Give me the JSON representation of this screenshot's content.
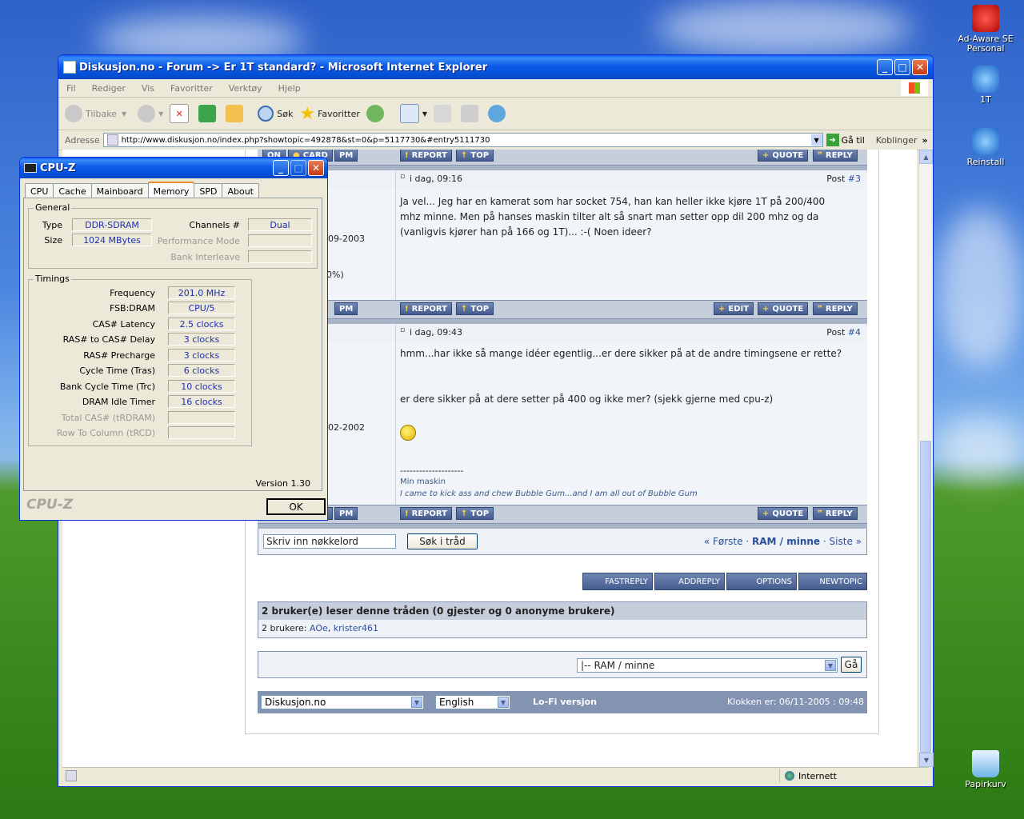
{
  "desktop": {
    "icons": [
      {
        "label": "Ad-Aware SE Personal"
      },
      {
        "label": "1T"
      },
      {
        "label": "Reinstall"
      },
      {
        "label": "Papirkurv"
      }
    ]
  },
  "ie": {
    "title": "Diskusjon.no - Forum -> Er 1T standard? - Microsoft Internet Explorer",
    "menu": [
      "Fil",
      "Rediger",
      "Vis",
      "Favoritter",
      "Verktøy",
      "Hjelp"
    ],
    "toolbar": {
      "back": "Tilbake",
      "search": "Søk",
      "favorites": "Favoritter"
    },
    "address": {
      "label": "Adresse",
      "url": "http://www.diskusjon.no/index.php?showtopic=492878&st=0&p=5117730&#entry5111730",
      "go": "Gå til",
      "links": "Koblinger"
    },
    "status": {
      "zone": "Internett"
    }
  },
  "forum": {
    "buttons": {
      "on": "ON",
      "card": "CARD",
      "pm": "PM",
      "report": "REPORT",
      "top": "TOP",
      "edit": "EDIT",
      "quote": "QUOTE",
      "reply": "REPLY"
    },
    "partial_left": {
      "date3": "09-2003",
      "percent3": "0%)",
      "date4": "02-2002"
    },
    "posts": [
      {
        "time": "i dag, 09:16",
        "post_label": "Post",
        "post_num": "#3",
        "text": "Ja vel... Jeg har en kamerat som har socket 754, han kan heller ikke kjøre 1T på 200/400 mhz minne. Men på hanses maskin tilter alt så snart man setter opp dil 200 mhz og da (vanligvis kjører han på 166 og 1T)... :-( Noen ideer?"
      },
      {
        "time": "i dag, 09:43",
        "post_label": "Post",
        "post_num": "#4",
        "text1": "hmm...har ikke så mange idéer egentlig...er dere sikker på at de andre timingsene er rette?",
        "text2": "er dere sikker på at dere setter på 400 og ikke mer? (sjekk gjerne med cpu-z)",
        "sig_line": "--------------------",
        "sig_link": "Min maskin",
        "sig_quote": "I came to kick ass and chew Bubble Gum...and I am all out of Bubble Gum"
      }
    ],
    "search": {
      "placeholder": "Skriv inn nøkkelord",
      "button": "Søk i tråd"
    },
    "pagination": {
      "first": "« Første",
      "sep1": "·",
      "current": "RAM / minne",
      "sep2": "·",
      "last": "Siste »"
    },
    "actions": {
      "fastreply": "FASTREPLY",
      "addreply": "ADDREPLY",
      "options": "OPTIONS",
      "newtopic": "NEWTOPIC"
    },
    "readers": {
      "header": "2 bruker(e) leser denne tråden (0 gjester og 0 anonyme brukere)",
      "prefix": "2 brukere:",
      "user1": "AOe",
      "comma": ",",
      "user2": "krister461"
    },
    "jump": {
      "selected": "|-- RAM / minne",
      "go": "Gå"
    },
    "footer": {
      "site": "Diskusjon.no",
      "lang": "English",
      "lofi": "Lo-Fi versjon",
      "clock": "Klokken er: 06/11-2005 : 09:48"
    }
  },
  "cpuz": {
    "title": "CPU-Z",
    "tabs": [
      "CPU",
      "Cache",
      "Mainboard",
      "Memory",
      "SPD",
      "About"
    ],
    "active_tab": "Memory",
    "general": {
      "legend": "General",
      "type_label": "Type",
      "type_value": "DDR-SDRAM",
      "size_label": "Size",
      "size_value": "1024 MBytes",
      "channels_label": "Channels #",
      "channels_value": "Dual",
      "perf_label": "Performance Mode",
      "bank_label": "Bank Interleave"
    },
    "timings": {
      "legend": "Timings",
      "rows": [
        {
          "label": "Frequency",
          "value": "201.0 MHz"
        },
        {
          "label": "FSB:DRAM",
          "value": "CPU/5"
        },
        {
          "label": "CAS# Latency",
          "value": "2.5 clocks"
        },
        {
          "label": "RAS# to CAS# Delay",
          "value": "3 clocks"
        },
        {
          "label": "RAS# Precharge",
          "value": "3 clocks"
        },
        {
          "label": "Cycle Time (Tras)",
          "value": "6 clocks"
        },
        {
          "label": "Bank Cycle Time (Trc)",
          "value": "10 clocks"
        },
        {
          "label": "DRAM Idle Timer",
          "value": "16 clocks"
        }
      ],
      "disabled": [
        {
          "label": "Total CAS# (tRDRAM)"
        },
        {
          "label": "Row To Column (tRCD)"
        }
      ]
    },
    "version": "Version 1.30",
    "brand": "CPU-Z",
    "ok": "OK"
  }
}
